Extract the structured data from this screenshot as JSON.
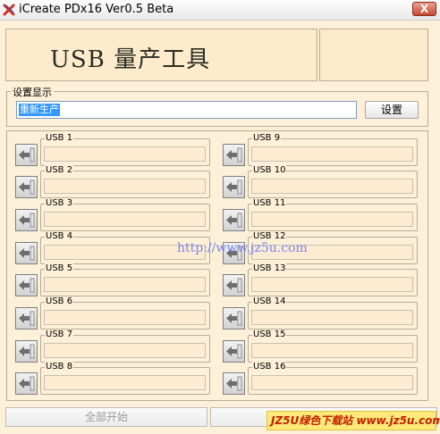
{
  "window": {
    "title": "iCreate PDx16 Ver0.5 Beta",
    "close_label": "X",
    "app_icon": "x-logo-icon"
  },
  "banner": {
    "title": "USB  量产工具"
  },
  "settings": {
    "group_label": "设置显示",
    "status_value": "重新生产",
    "button_label": "设置"
  },
  "usb_ports": [
    {
      "label": "USB 1"
    },
    {
      "label": "USB 2"
    },
    {
      "label": "USB 3"
    },
    {
      "label": "USB 4"
    },
    {
      "label": "USB 5"
    },
    {
      "label": "USB 6"
    },
    {
      "label": "USB 7"
    },
    {
      "label": "USB 8"
    },
    {
      "label": "USB 9"
    },
    {
      "label": "USB 10"
    },
    {
      "label": "USB 11"
    },
    {
      "label": "USB 12"
    },
    {
      "label": "USB 13"
    },
    {
      "label": "USB 14"
    },
    {
      "label": "USB 15"
    },
    {
      "label": "USB 16"
    }
  ],
  "watermark": "http://www.jz5u.com",
  "footer": {
    "start_all_label": "全部开始",
    "badge_text": "JZ5U绿色下载站 www.jz5u.com"
  },
  "colors": {
    "background": "#fdf0d8",
    "selection": "#3399ff",
    "watermark": "#7b88ee"
  }
}
